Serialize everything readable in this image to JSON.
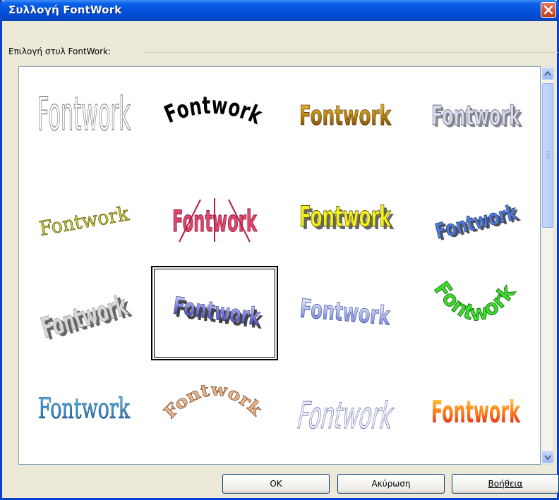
{
  "window": {
    "title": "Συλλογή FontWork"
  },
  "group": {
    "label": "Επιλογή στυλ FontWork:"
  },
  "gallery": {
    "items": [
      {
        "text": "Fontwork"
      },
      {
        "text": "Fontwork"
      },
      {
        "text": "Fontwork"
      },
      {
        "text": "Fontwork"
      },
      {
        "text": "Fontwork"
      },
      {
        "text": "Fontwork"
      },
      {
        "text": "Fontwork"
      },
      {
        "text": "Fontwork"
      },
      {
        "text": "Fontwork"
      },
      {
        "text": "Fontwork"
      },
      {
        "text": "Fontwork"
      },
      {
        "text": "Fontwork"
      },
      {
        "text": "Fontwork"
      },
      {
        "text": "Fontwork"
      },
      {
        "text": "Fontwork"
      },
      {
        "text": "Fontwork"
      }
    ],
    "selected_index": 9
  },
  "buttons": {
    "ok": "OK",
    "cancel": "Ακύρωση",
    "help": "Βοήθεια"
  },
  "icons": {
    "close": "close-icon",
    "scroll_up": "chevron-up-icon",
    "scroll_down": "chevron-down-icon"
  }
}
